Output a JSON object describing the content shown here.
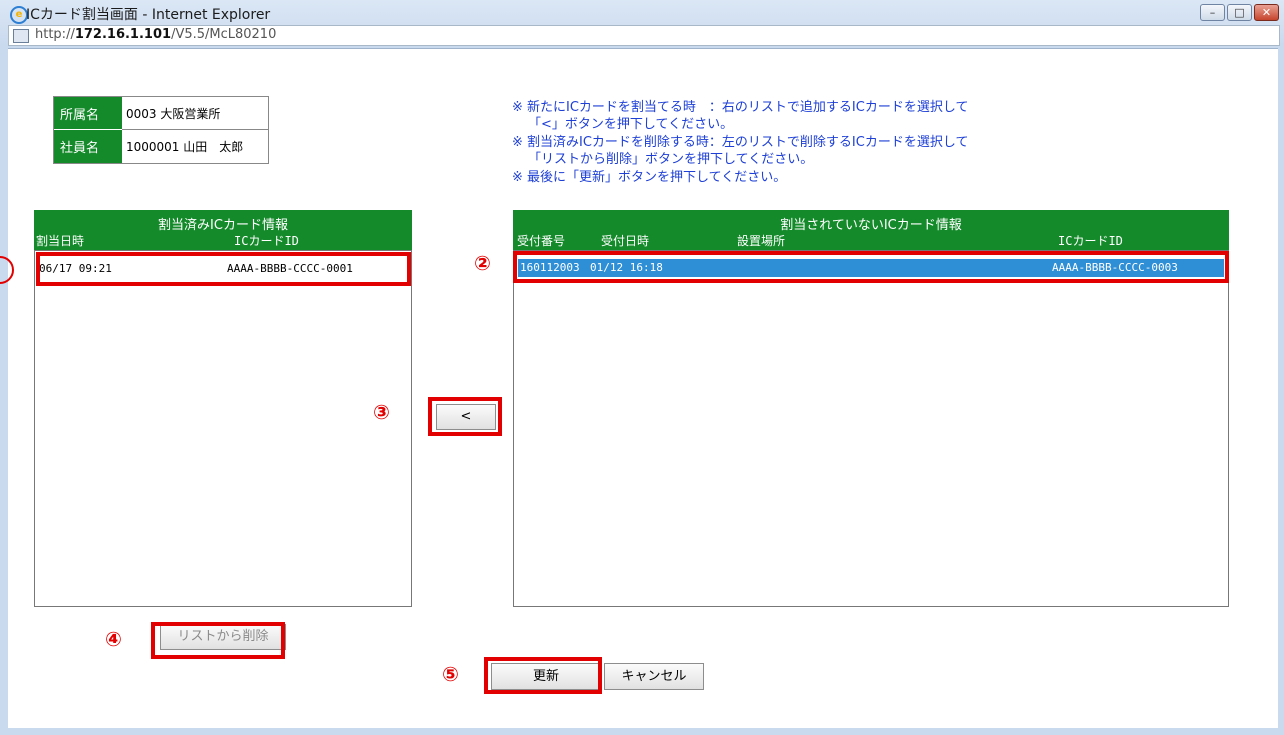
{
  "window": {
    "title": "ICカード割当画面 - Internet Explorer",
    "url_prefix": "http://",
    "url_host": "172.16.1.101",
    "url_path": "/V5.5/McL80210",
    "minimize_icon": "minimize-icon",
    "maximize_icon": "maximize-icon",
    "close_icon": "close-icon"
  },
  "info": {
    "dept_label": "所属名",
    "dept_value": "0003 大阪営業所",
    "employee_label": "社員名",
    "employee_value": "1000001 山田　太郎"
  },
  "instructions": [
    "※ 新たにICカードを割当てる時　：右のリストで追加するICカードを選択して",
    "「<」ボタンを押下してください。",
    "※ 割当済みICカードを削除する時：左のリストで削除するICカードを選択して",
    "「リストから削除」ボタンを押下してください。",
    "※ 最後に「更新」ボタンを押下してください。"
  ],
  "assigned_list": {
    "title": "割当済みICカード情報",
    "columns": [
      "割当日時",
      "ICカードID"
    ],
    "rows": [
      {
        "datetime": "06/17 09:21",
        "card_id": "AAAA-BBBB-CCCC-0001"
      }
    ]
  },
  "unassigned_list": {
    "title": "割当されていないICカード情報",
    "columns": [
      "受付番号",
      "受付日時",
      "設置場所",
      "ICカードID"
    ],
    "rows": [
      {
        "reception_no": "160112003",
        "datetime": "01/12 16:18",
        "location": "",
        "card_id": "AAAA-BBBB-CCCC-0003",
        "selected": true
      }
    ]
  },
  "buttons": {
    "move_left": "<",
    "remove_from_list": "リストから削除",
    "update": "更新",
    "cancel": "キャンセル"
  },
  "markers": [
    "②",
    "③",
    "④",
    "⑤"
  ],
  "colors": {
    "header_green": "#148a2b",
    "highlight_red": "#e30000",
    "instruction_blue": "#1d3fd6",
    "selected_row": "#2f8fd6"
  }
}
